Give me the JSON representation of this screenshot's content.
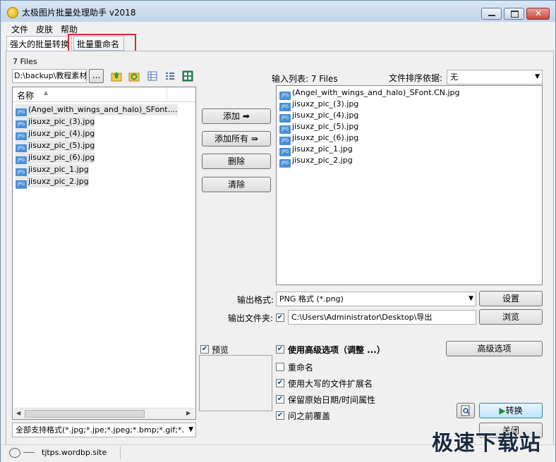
{
  "window": {
    "title": "太极图片批量处理助手  v2018"
  },
  "menu": [
    "文件",
    "皮肤",
    "帮助"
  ],
  "tabs": [
    "强大的批量转换",
    "批量重命名"
  ],
  "left": {
    "file_count": "7 Files",
    "path": "D:\\backup\\教程素材",
    "browse_label": "...",
    "column_header": "名称",
    "files": [
      "(Angel_with_wings_and_halo)_SFont....",
      "jisuxz_pic_(3).jpg",
      "jisuxz_pic_(4).jpg",
      "jisuxz_pic_(5).jpg",
      "jisuxz_pic_(6).jpg",
      "jisuxz_pic_1.jpg",
      "jisuxz_pic_2.jpg"
    ],
    "filter": "全部支持格式(*.jpg;*.jpe;*.jpeg;*.bmp;*.gif;*."
  },
  "buttons": {
    "add": "添加",
    "add_all": "添加所有",
    "remove": "删除",
    "clear": "清除",
    "settings": "设置",
    "browse": "浏览",
    "advanced": "高级选项",
    "convert": "转换",
    "close": "关闭"
  },
  "right": {
    "input_list_label": "输入列表: 7 Files",
    "sort_label": "文件排序依据:",
    "sort_value": "无",
    "files": [
      "(Angel_with_wings_and_halo)_SFont.CN.jpg",
      "jisuxz_pic_(3).jpg",
      "jisuxz_pic_(4).jpg",
      "jisuxz_pic_(5).jpg",
      "jisuxz_pic_(6).jpg",
      "jisuxz_pic_1.jpg",
      "jisuxz_pic_2.jpg"
    ]
  },
  "output": {
    "format_label": "输出格式:",
    "format_value": "PNG 格式  (*.png)",
    "folder_label": "输出文件夹:",
    "folder_value": "C:\\Users\\Administrator\\Desktop\\导出"
  },
  "options": {
    "preview": "预览",
    "use_advanced": "使用高级选项（调整 ...）",
    "rename": "重命名",
    "uppercase_ext": "使用大写的文件扩展名",
    "keep_date": "保留原始日期/时间属性",
    "ask_overwrite": "问之前覆盖"
  },
  "status": {
    "site": "tjtps.wordbp.site"
  },
  "watermark": "极速下载站",
  "colors": {
    "highlight": "#e0272a",
    "title_bg": "#c2d4ea"
  }
}
